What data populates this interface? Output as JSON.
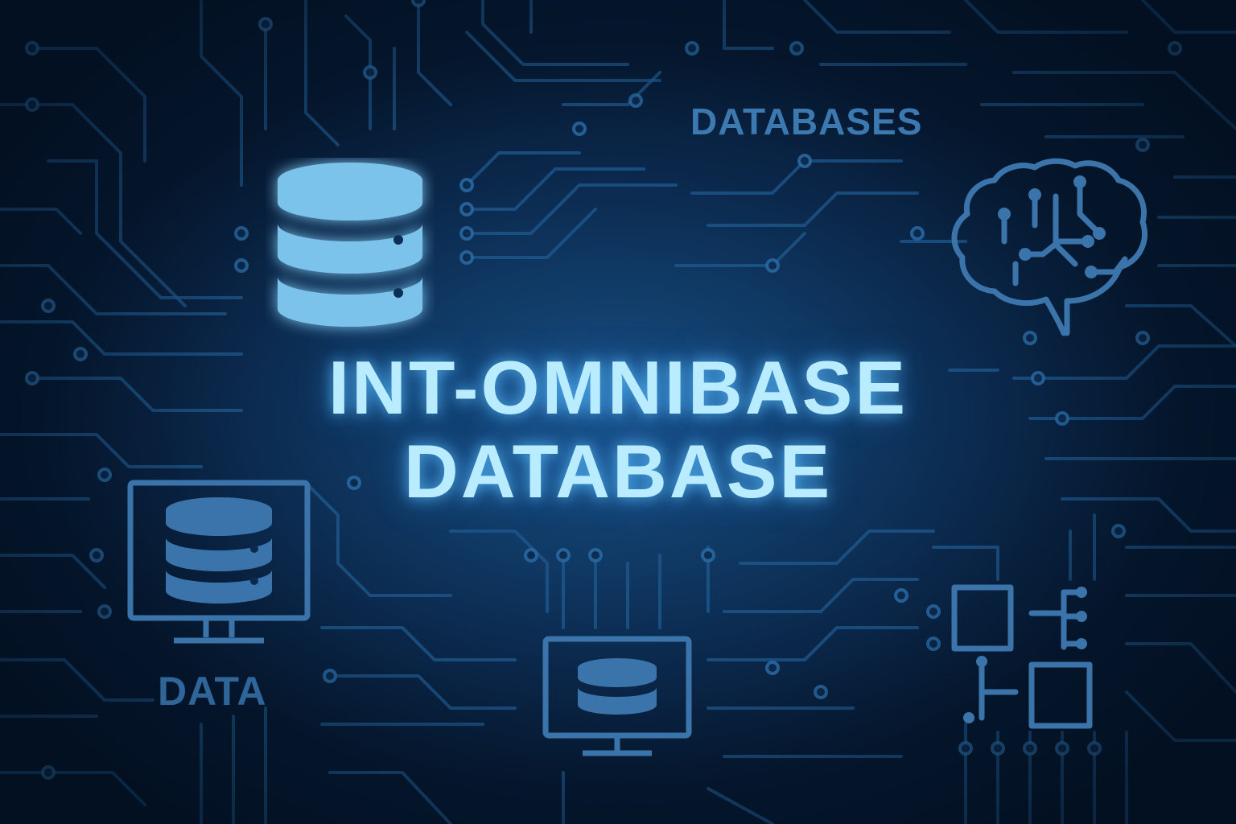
{
  "labels": {
    "databases": "DATABASES",
    "data": "DATA"
  },
  "title": {
    "line1": "INT-OMNIBASE",
    "line2": "DATABASE"
  },
  "icons": [
    "database-icon",
    "brain-circuit-icon",
    "monitor-database-icon",
    "monitor-database-small-icon",
    "network-diagram-icon"
  ],
  "colors": {
    "background_dark": "#061a33",
    "background_glow": "#1a4f86",
    "circuit": "#1f5a8f",
    "title": "#b9ecff",
    "icon_bright": "#7cc3ec",
    "icon_dim": "#3b74aa"
  }
}
